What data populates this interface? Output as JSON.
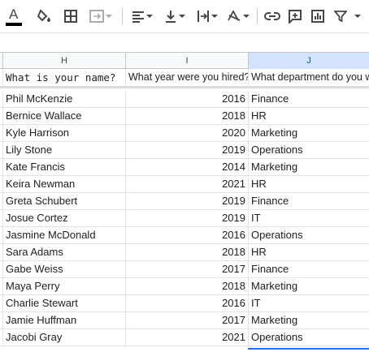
{
  "toolbar": {
    "items": [
      {
        "name": "text-color-icon",
        "glyph": "A"
      },
      {
        "name": "fill-color-icon"
      },
      {
        "name": "borders-icon"
      },
      {
        "name": "merge-cells-icon"
      },
      {
        "name": "horizontal-align-icon"
      },
      {
        "name": "vertical-align-icon"
      },
      {
        "name": "text-wrapping-icon"
      },
      {
        "name": "text-rotation-icon"
      },
      {
        "name": "insert-link-icon"
      },
      {
        "name": "insert-comment-icon"
      },
      {
        "name": "insert-chart-icon"
      },
      {
        "name": "filter-icon"
      }
    ],
    "text_color": "#000000"
  },
  "columns": {
    "H": "H",
    "I": "I",
    "J": "J"
  },
  "header_row": {
    "H": "What is your name?",
    "I": "What year were you hired?",
    "J": "What department do you work in?"
  },
  "rows": [
    {
      "name": "Phil McKenzie",
      "year": "2016",
      "dept": "Finance"
    },
    {
      "name": "Bernice Wallace",
      "year": "2018",
      "dept": "HR"
    },
    {
      "name": "Kyle Harrison",
      "year": "2020",
      "dept": "Marketing"
    },
    {
      "name": "Lily Stone",
      "year": "2019",
      "dept": "Operations"
    },
    {
      "name": "Kate Francis",
      "year": "2014",
      "dept": "Marketing"
    },
    {
      "name": "Keira Newman",
      "year": "2021",
      "dept": "HR"
    },
    {
      "name": "Greta Schubert",
      "year": "2019",
      "dept": "Finance"
    },
    {
      "name": "Josue Cortez",
      "year": "2019",
      "dept": "IT"
    },
    {
      "name": "Jasmine McDonald",
      "year": "2016",
      "dept": "Operations"
    },
    {
      "name": "Sara Adams",
      "year": "2018",
      "dept": "HR"
    },
    {
      "name": "Gabe Weiss",
      "year": "2017",
      "dept": "Finance"
    },
    {
      "name": "Maya Perry",
      "year": "2018",
      "dept": "Marketing"
    },
    {
      "name": "Charlie Stewart",
      "year": "2016",
      "dept": "IT"
    },
    {
      "name": "Jamie Huffman",
      "year": "2017",
      "dept": "Marketing"
    },
    {
      "name": "Jacobi Gray",
      "year": "2021",
      "dept": "Operations"
    }
  ],
  "colors": {
    "selected_header_bg": "#d3e3fd",
    "selection_border": "#1a73e8"
  }
}
